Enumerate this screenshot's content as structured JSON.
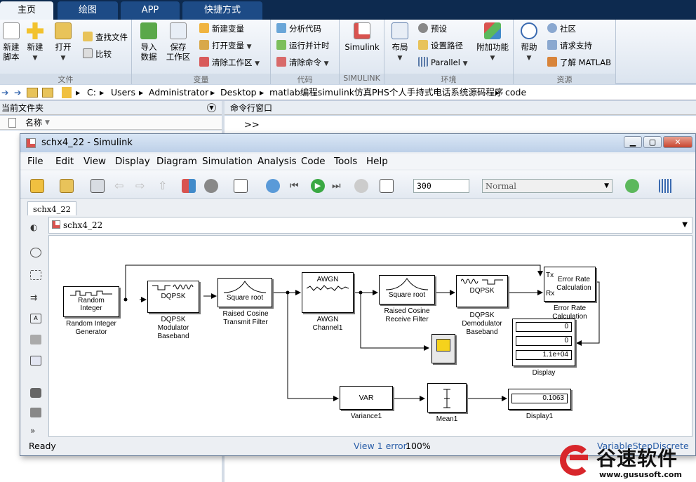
{
  "matlab": {
    "tabs": [
      "主页",
      "绘图",
      "APP",
      "快捷方式"
    ],
    "ribbon": {
      "file": {
        "caption": "文件",
        "new_script": "新建\n脚本",
        "new": "新建",
        "open": "打开",
        "find_files": "查找文件",
        "compare": "比较"
      },
      "variable": {
        "caption": "变量",
        "import": "导入\n数据",
        "save_ws": "保存\n工作区",
        "new_var": "新建变量",
        "open_var": "打开变量",
        "clear_ws": "清除工作区"
      },
      "code": {
        "caption": "代码",
        "analyze": "分析代码",
        "run_time": "运行并计时",
        "clear_cmd": "清除命令"
      },
      "simulink": {
        "caption": "SIMULINK",
        "label": "Simulink"
      },
      "env": {
        "caption": "环境",
        "layout": "布局",
        "prefs": "预设",
        "set_path": "设置路径",
        "parallel": "Parallel",
        "addons": "附加功能"
      },
      "resources": {
        "caption": "资源",
        "help": "帮助",
        "community": "社区",
        "support": "请求支持",
        "learn": "了解 MATLAB"
      }
    },
    "path": [
      "C:",
      "Users",
      "Administrator",
      "Desktop",
      "matlab编程simulink仿真PHS个人手持式电话系统源码程序",
      "code"
    ],
    "current_folder_title": "当前文件夹",
    "name_col": "名称",
    "command_window_title": "命令行窗口",
    "prompt": ">>"
  },
  "simulink": {
    "window_title": "schx4_22 - Simulink",
    "menu": [
      "File",
      "Edit",
      "View",
      "Display",
      "Diagram",
      "Simulation",
      "Analysis",
      "Code",
      "Tools",
      "Help"
    ],
    "stop_time": "300",
    "sim_mode": "Normal",
    "model_tab": "schx4_22",
    "breadcrumb": "schx4_22",
    "status_left": "Ready",
    "status_mid": "View 1 error",
    "zoom": "100%",
    "solver": "VariableStepDiscrete",
    "blocks": {
      "rand_int": {
        "inner": "Random\nInteger",
        "label": "Random Integer\nGenerator"
      },
      "dqpsk_mod": {
        "inner": "DQPSK",
        "label": "DQPSK\nModulator\nBaseband"
      },
      "rc_tx": {
        "inner": "Square root",
        "label": "Raised Cosine\nTransmit Filter"
      },
      "awgn": {
        "inner": "AWGN",
        "label": "AWGN\nChannel1"
      },
      "rc_rx": {
        "inner": "Square root",
        "label": "Raised Cosine\nReceive Filter"
      },
      "dqpsk_demod": {
        "inner": "DQPSK",
        "label": "DQPSK\nDemodulator\nBaseband"
      },
      "err_rate": {
        "inner": "Error Rate\nCalculation",
        "tx": "Tx",
        "rx": "Rx",
        "label": "Error Rate\nCalculation"
      },
      "display": {
        "values": [
          "0",
          "0",
          "1.1e+04"
        ],
        "label": "Display"
      },
      "variance": {
        "inner": "VAR",
        "label": "Variance1"
      },
      "mean": {
        "label": "Mean1"
      },
      "display1": {
        "value": "0.1063",
        "label": "Display1"
      }
    }
  },
  "watermark": {
    "brand": "谷速软件",
    "url": "www.gususoft.com"
  }
}
